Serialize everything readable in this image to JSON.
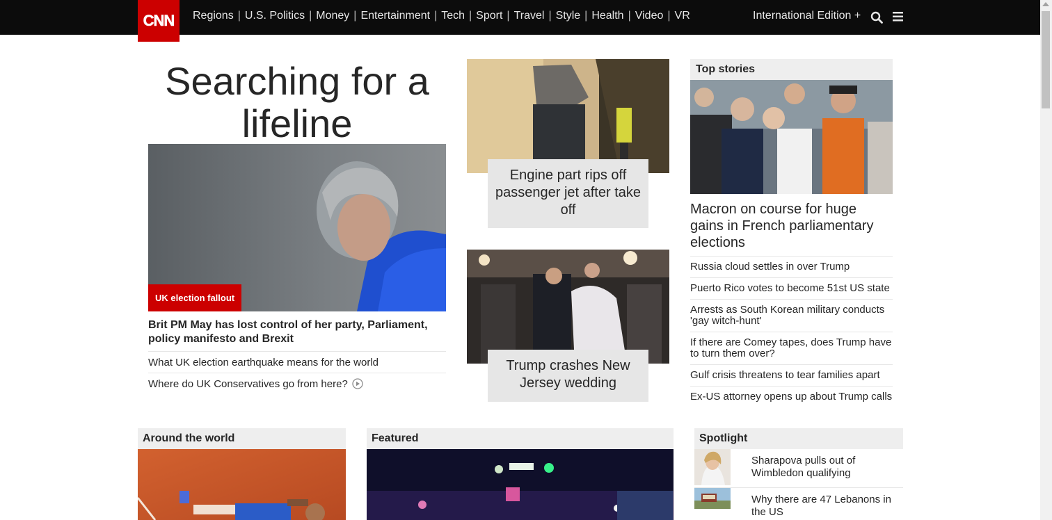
{
  "header": {
    "logo_text": "CNN",
    "nav": [
      "Regions",
      "U.S. Politics",
      "Money",
      "Entertainment",
      "Tech",
      "Sport",
      "Travel",
      "Style",
      "Health",
      "Video",
      "VR"
    ],
    "edition": "International Edition +",
    "icons": [
      "search-icon",
      "menu-icon"
    ],
    "colors": {
      "bar": "#0c0c0c",
      "logo": "#cc0000"
    }
  },
  "lead": {
    "headline": "Searching for a lifeline",
    "badge": "UK election fallout",
    "title": "Brit PM May has lost control of her party, Parliament, policy manifesto and Brexit",
    "links": [
      {
        "label": "What UK election earthquake means for the world",
        "video": false
      },
      {
        "label": "Where do UK Conservatives go from here?",
        "video": true
      }
    ]
  },
  "middle": {
    "story1": "Engine part rips off passenger jet after take off",
    "story2": "Trump crashes New Jersey wedding"
  },
  "top_stories": {
    "heading": "Top stories",
    "main_title": "Macron on course for huge gains in French parliamentary elections",
    "items": [
      "Russia cloud settles in over Trump",
      "Puerto Rico votes to become 51st US state",
      "Arrests as South Korean military conducts 'gay witch-hunt'",
      "If there are Comey tapes, does Trump have to turn them over?",
      "Gulf crisis threatens to tear families apart",
      "Ex-US attorney opens up about Trump calls"
    ]
  },
  "sections": {
    "around": "Around the world",
    "featured": "Featured",
    "spotlight": "Spotlight"
  },
  "spotlight": {
    "items": [
      "Sharapova pulls out of Wimbledon qualifying",
      "Why there are 47 Lebanons in the US"
    ]
  }
}
